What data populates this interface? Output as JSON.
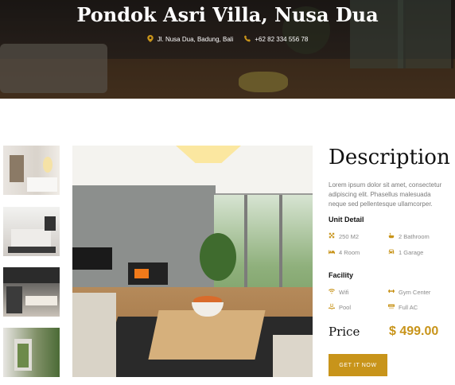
{
  "hero": {
    "title": "Pondok Asri Villa, Nusa Dua",
    "address": "Jl. Nusa Dua, Badung, Bali",
    "phone": "+62 82 334 556 78",
    "address_icon": "location-pin-icon",
    "phone_icon": "phone-icon"
  },
  "gallery": {
    "thumbnails": [
      "bedroom-thumbnail",
      "bedroom-2-thumbnail",
      "kitchen-thumbnail",
      "entrance-thumbnail"
    ],
    "main_image": "living-room-image"
  },
  "description": {
    "title": "Description",
    "text": "Lorem ipsum dolor sit amet, consectetur adipiscing elit. Phasellus malesuada neque sed pellentesque ullamcorper."
  },
  "unit_detail": {
    "title": "Unit Detail",
    "items": [
      {
        "label": "250 M2",
        "icon": "area-icon"
      },
      {
        "label": "2 Bathroom",
        "icon": "bathtub-icon"
      },
      {
        "label": "4 Room",
        "icon": "bed-icon"
      },
      {
        "label": "1 Garage",
        "icon": "car-icon"
      }
    ]
  },
  "facility": {
    "title": "Facility",
    "items": [
      {
        "label": "Wifi",
        "icon": "wifi-icon"
      },
      {
        "label": "Gym Center",
        "icon": "dumbbell-icon"
      },
      {
        "label": "Pool",
        "icon": "pool-icon"
      },
      {
        "label": "Full AC",
        "icon": "ac-icon"
      }
    ]
  },
  "price": {
    "label": "Price",
    "value": "$ 499.00"
  },
  "cta": {
    "label": "GET IT NOW"
  },
  "colors": {
    "accent": "#c8941a",
    "heading": "#111111",
    "muted": "#8a8a8a"
  }
}
